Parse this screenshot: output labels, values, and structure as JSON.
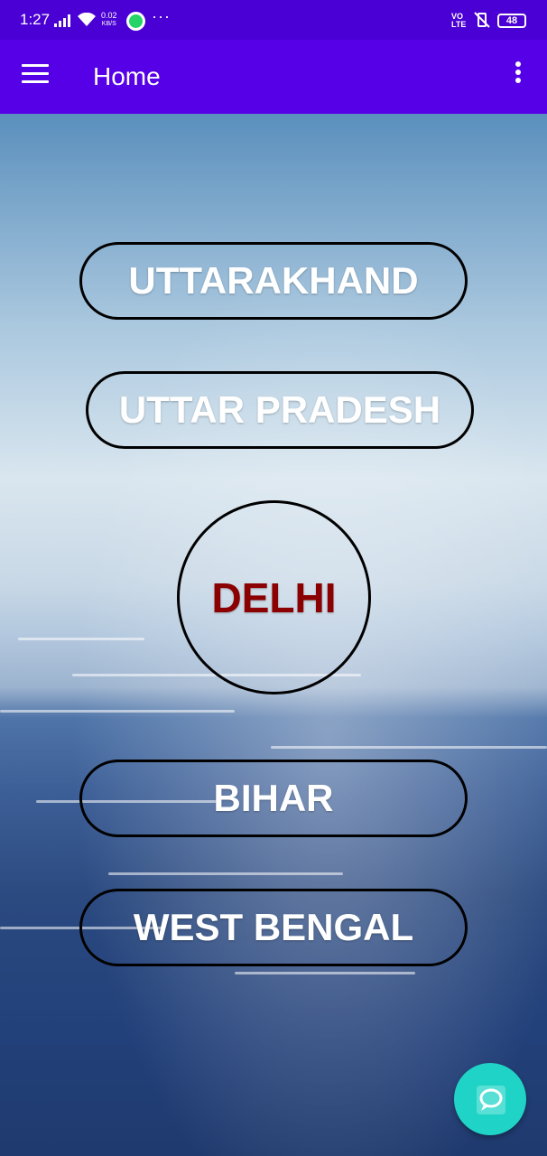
{
  "status_bar": {
    "time": "1:27",
    "net_speed_value": "0.02",
    "net_speed_unit": "KB/S",
    "volte_top": "VO",
    "volte_bottom": "LTE",
    "battery": "48"
  },
  "app_bar": {
    "title": "Home"
  },
  "states": [
    {
      "label": "UTTARAKHAND"
    },
    {
      "label": "UTTAR PRADESH"
    },
    {
      "label": "DELHI"
    },
    {
      "label": "BIHAR"
    },
    {
      "label": "WEST BENGAL"
    }
  ],
  "colors": {
    "status_bar": "#4a00d4",
    "app_bar": "#5600e8",
    "delhi_text": "#8b0000",
    "fab": "#1fd3c6"
  }
}
